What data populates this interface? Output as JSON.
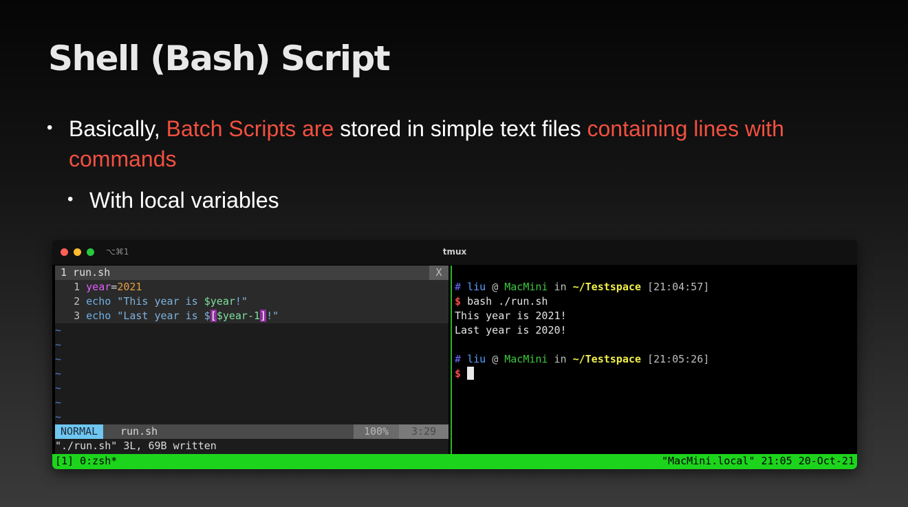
{
  "slide": {
    "title": "Shell (Bash) Script",
    "bullet1": {
      "part1": "Basically, ",
      "part2": "Batch Scripts are",
      "part3": " stored in simple text files ",
      "part4": "containing lines with commands"
    },
    "bullet2": "With local variables",
    "accent_color": "#f25040"
  },
  "terminal": {
    "shortcut": "⌥⌘1",
    "title": "tmux",
    "vim": {
      "tab_label": "1 run.sh",
      "tab_close": "X",
      "lines": [
        {
          "num": "1",
          "a": "year",
          "b": "=",
          "c": "2021"
        },
        {
          "num": "2",
          "kw": "echo",
          "s1": " \"This year is ",
          "v": "$year",
          "s2": "!\""
        },
        {
          "num": "3",
          "kw": "echo",
          "s1": " \"Last year is $",
          "b1": "[",
          "v": "$year-1",
          "b2": "]",
          "s2": "!\""
        }
      ],
      "tilde": "~",
      "mode": "NORMAL",
      "file": "run.sh",
      "percent": "100%",
      "position": "3:29",
      "message": "\"./run.sh\" 3L, 69B written"
    },
    "shell": {
      "prompt1": {
        "hash": "#",
        "user": "liu",
        "at": "@",
        "host": "MacMini",
        "in": "in",
        "dir": "~/Testspace",
        "time": "[21:04:57]"
      },
      "cmd": {
        "dollar": "$",
        "text": "bash ./run.sh"
      },
      "output": [
        "This year is 2021!",
        "Last year is 2020!"
      ],
      "prompt2": {
        "hash": "#",
        "user": "liu",
        "at": "@",
        "host": "MacMini",
        "in": "in",
        "dir": "~/Testspace",
        "time": "[21:05:26]"
      },
      "dollar2": "$"
    },
    "tmux_status": {
      "left": "[1] 0:zsh*",
      "right": "\"MacMini.local\" 21:05 20-Oct-21",
      "color": "#1dd41d"
    }
  }
}
